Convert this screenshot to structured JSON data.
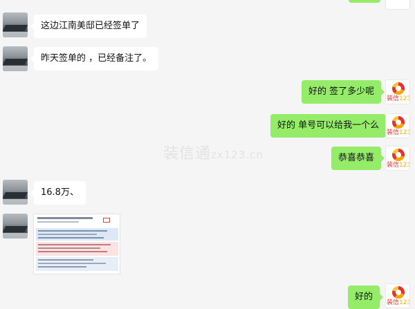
{
  "messages": [
    {
      "side": "left",
      "text": "这边江南美邸已经签单了"
    },
    {
      "side": "left",
      "text": "昨天签单的 ，已经备注了。"
    },
    {
      "side": "right",
      "text": "好的 签了多少呢"
    },
    {
      "side": "right",
      "text": "好的 单号可以给我一个么"
    },
    {
      "side": "right",
      "text": "恭喜恭喜"
    },
    {
      "side": "left",
      "text": "16.8万、"
    },
    {
      "side": "right",
      "text": "好的"
    }
  ],
  "watermark": {
    "main": "装信通",
    "domain": "zx123.cn"
  },
  "right_avatar": {
    "brand": "装信",
    "num": "123"
  },
  "colors": {
    "sent_bubble": "#95ec69",
    "received_bubble": "#ffffff",
    "background": "#f5f5f5"
  }
}
